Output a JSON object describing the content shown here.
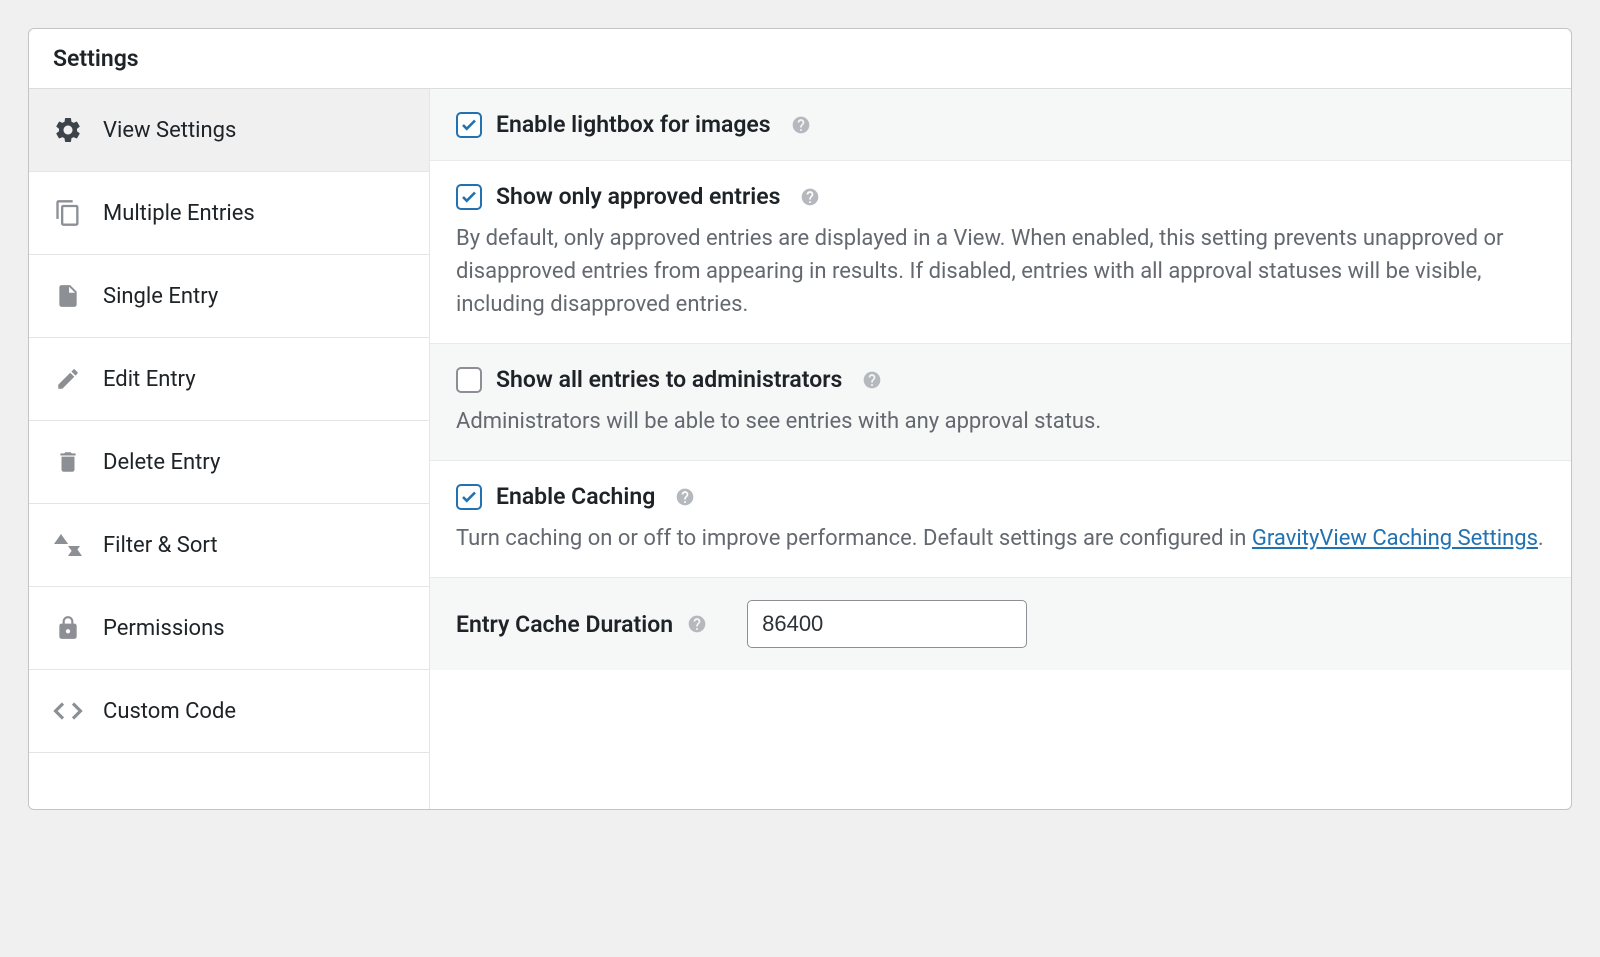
{
  "panel": {
    "title": "Settings"
  },
  "sidebar": {
    "items": [
      {
        "label": "View Settings",
        "icon": "gear-icon",
        "active": true
      },
      {
        "label": "Multiple Entries",
        "icon": "copies-icon",
        "active": false
      },
      {
        "label": "Single Entry",
        "icon": "file-icon",
        "active": false
      },
      {
        "label": "Edit Entry",
        "icon": "pencil-icon",
        "active": false
      },
      {
        "label": "Delete Entry",
        "icon": "trash-icon",
        "active": false
      },
      {
        "label": "Filter & Sort",
        "icon": "sort-icon",
        "active": false
      },
      {
        "label": "Permissions",
        "icon": "lock-icon",
        "active": false
      },
      {
        "label": "Custom Code",
        "icon": "code-icon",
        "active": false
      }
    ]
  },
  "settings": {
    "lightbox": {
      "label": "Enable lightbox for images",
      "checked": true
    },
    "approved": {
      "label": "Show only approved entries",
      "checked": true,
      "description": "By default, only approved entries are displayed in a View. When enabled, this setting prevents unapproved or disapproved entries from appearing in results. If disabled, entries with all approval statuses will be visible, including disapproved entries."
    },
    "adminAll": {
      "label": "Show all entries to administrators",
      "checked": false,
      "description": "Administrators will be able to see entries with any approval status."
    },
    "caching": {
      "label": "Enable Caching",
      "checked": true,
      "descriptionPrefix": "Turn caching on or off to improve performance. Default settings are configured in ",
      "link": "GravityView Caching Settings",
      "descriptionSuffix": "."
    },
    "cacheDuration": {
      "label": "Entry Cache Duration",
      "value": "86400"
    }
  }
}
